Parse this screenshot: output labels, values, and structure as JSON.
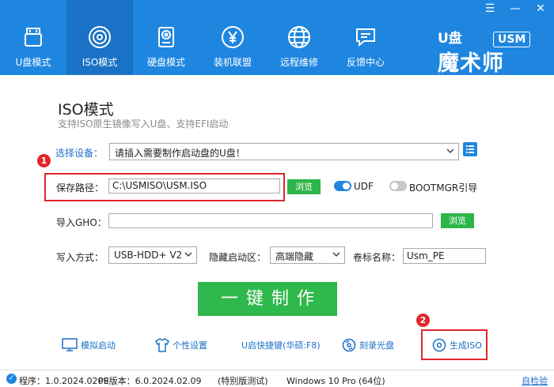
{
  "header": {
    "nav": [
      {
        "label": "U盘模式",
        "icon": "usb-drive-icon"
      },
      {
        "label": "ISO模式",
        "icon": "disc-icon"
      },
      {
        "label": "硬盘模式",
        "icon": "hard-disk-icon"
      },
      {
        "label": "装机联盟",
        "icon": "yen-coin-icon"
      },
      {
        "label": "远程维修",
        "icon": "globe-icon"
      },
      {
        "label": "反馈中心",
        "icon": "chat-icon"
      }
    ],
    "logo": {
      "u": "U盘",
      "usm": "USM",
      "cn": "魔术师"
    },
    "window": {
      "menu": "☰",
      "minimize": "—",
      "close": "✕"
    }
  },
  "main": {
    "title": "ISO模式",
    "subtitle": "支持ISO原生镜像写入U盘、支持EFI启动",
    "device": {
      "label": "选择设备：",
      "value": "请插入需要制作启动盘的U盘！"
    },
    "save_path": {
      "label": "保存路径：",
      "value": "C:\\USMISO\\USM.ISO",
      "browse": "浏览"
    },
    "udf": {
      "label": "UDF",
      "on": true
    },
    "bootmgr": {
      "label": "BOOTMGR引导",
      "on": false
    },
    "gho": {
      "label": "导入GHO：",
      "value": "",
      "browse": "浏览"
    },
    "write_mode": {
      "label": "写入方式：",
      "value": "USB-HDD+ V2"
    },
    "hidden_part": {
      "label": "隐藏启动区：",
      "value": "高端隐藏"
    },
    "volume": {
      "label": "卷标名称：",
      "value": "Usm_PE"
    },
    "make_button": "一键制作",
    "badges": [
      "1",
      "2"
    ]
  },
  "tools": [
    {
      "label": "模拟启动",
      "icon": "monitor-icon"
    },
    {
      "label": "个性设置",
      "icon": "tshirt-icon"
    },
    {
      "label": "U启快捷键(华硕:F8)",
      "icon": ""
    },
    {
      "label": "刻录光盘",
      "icon": "burn-disc-icon"
    },
    {
      "label": "生成ISO",
      "icon": "iso-disc-icon"
    }
  ],
  "status": {
    "version": "程序：1.0.2024.0209",
    "pe": "PE版本：6.0.2024.02.09",
    "edition": "(特别版测试)",
    "os": "Windows 10 Pro (64位)",
    "link": "自检验"
  },
  "colors": {
    "brand_blue": "#1f86e0",
    "green": "#2db549",
    "highlight_red": "#e0262b",
    "link_blue": "#1a6fc9"
  }
}
